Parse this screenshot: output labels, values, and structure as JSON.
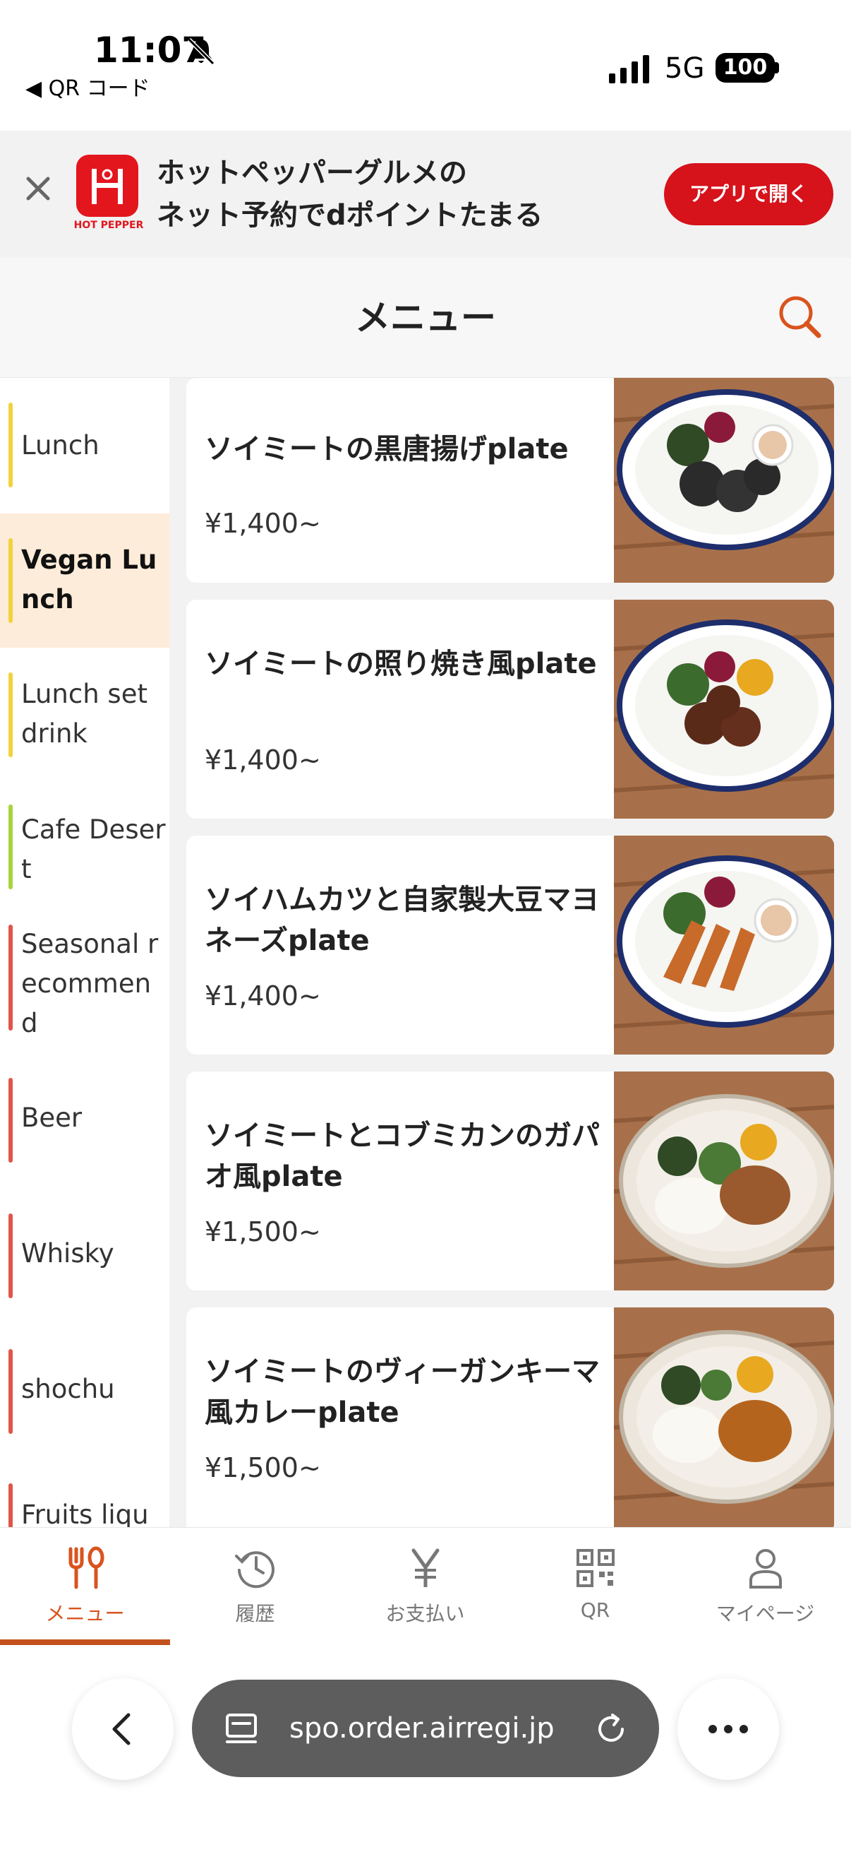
{
  "status_bar": {
    "time": "11:07",
    "back_app": "◀ QR コード",
    "network": "5G",
    "battery": "100"
  },
  "banner": {
    "logo_caption": "HOT PEPPER",
    "text_line1": "ホットペッパーグルメの",
    "text_line2": "ネット予約でdポイントたまる",
    "open_button": "アプリで開く"
  },
  "header": {
    "title": "メニュー"
  },
  "sidebar": {
    "categories": [
      {
        "label": "Lunch",
        "color": "#f2d23c"
      },
      {
        "label": "Vegan Lunch",
        "color": "#f2d23c",
        "active": true
      },
      {
        "label": "Lunch set drink",
        "color": "#f2d23c"
      },
      {
        "label": "Cafe Desert",
        "color": "#a6d43c"
      },
      {
        "label": "Seasonal recommend",
        "color": "#e0554a"
      },
      {
        "label": "Beer",
        "color": "#e0554a"
      },
      {
        "label": "Whisky",
        "color": "#e0554a"
      },
      {
        "label": "shochu",
        "color": "#e0554a"
      },
      {
        "label": "Fruits liqu",
        "color": "#e0554a"
      }
    ]
  },
  "menu_items": [
    {
      "name": "ソイミートの黒唐揚げplate",
      "price": "¥1,400~"
    },
    {
      "name": "ソイミートの照り焼き風plate",
      "price": "¥1,400~"
    },
    {
      "name": "ソイハムカツと自家製大豆マヨネーズplate",
      "price": "¥1,400~"
    },
    {
      "name": "ソイミートとコブミカンのガパオ風plate",
      "price": "¥1,500~"
    },
    {
      "name": "ソイミートのヴィーガンキーマ風カレーplate",
      "price": "¥1,500~"
    }
  ],
  "bottom_nav": {
    "items": [
      {
        "label": "メニュー",
        "icon": "fork-spoon-icon",
        "active": true
      },
      {
        "label": "履歴",
        "icon": "history-icon"
      },
      {
        "label": "お支払い",
        "icon": "yen-icon"
      },
      {
        "label": "QR",
        "icon": "qr-icon"
      },
      {
        "label": "マイページ",
        "icon": "person-icon"
      }
    ]
  },
  "browser": {
    "url": "spo.order.airregi.jp"
  },
  "colors": {
    "accent": "#d9531e",
    "banner_button": "#d6121b",
    "active_category_bg": "#fdecd9"
  }
}
